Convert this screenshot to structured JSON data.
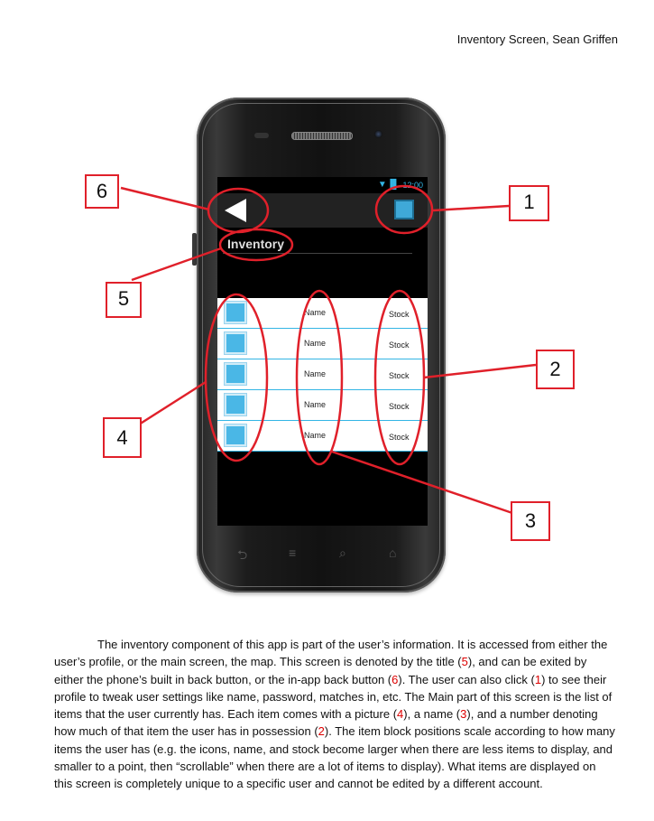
{
  "header": {
    "text": "Inventory Screen, Sean Griffen"
  },
  "phone": {
    "status_time": "12:00",
    "screen_title": "Inventory",
    "list_rows": [
      {
        "name": "Name",
        "stock": "Stock"
      },
      {
        "name": "Name",
        "stock": "Stock"
      },
      {
        "name": "Name",
        "stock": "Stock"
      },
      {
        "name": "Name",
        "stock": "Stock"
      },
      {
        "name": "Name",
        "stock": "Stock"
      }
    ]
  },
  "callouts": {
    "c1": "1",
    "c2": "2",
    "c3": "3",
    "c4": "4",
    "c5": "5",
    "c6": "6"
  },
  "paragraph": {
    "s1": "The inventory component of this app is part of the user’s information. It is accessed from either the user’s profile, or the main screen, the map. This screen is denoted by the title (",
    "r5": "5",
    "s2": "), and can be exited by either the phone’s built in back button, or the in-app back button (",
    "r6": "6",
    "s3": "). The user can also click (",
    "r1": "1",
    "s4": ") to see their profile to tweak user settings like name, password, matches in, etc. The Main part of this screen is the list of items that the user currently has. Each item comes with a picture (",
    "r4": "4",
    "s5": "), a name (",
    "r3": "3",
    "s6": "), and a number denoting how much of that item the user has in possession (",
    "r2": "2",
    "s7": "). The item block positions scale according to how many items the user has (e.g. the icons, name, and stock become larger when there are less items to display, and smaller to a point, then “scrollable” when there are a lot of items to display). What items are displayed on this screen is completely unique to a specific user and cannot be edited by a different account."
  },
  "colors": {
    "accent": "#33b5e5",
    "callout_red": "#e0202a",
    "item_icon": "#4ab7e6"
  }
}
